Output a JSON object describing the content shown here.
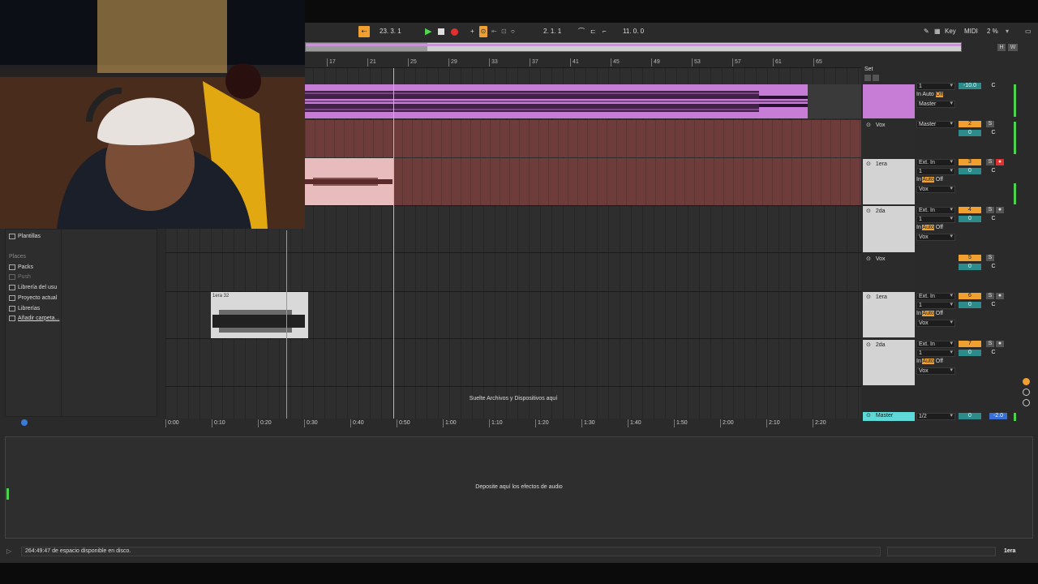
{
  "transport": {
    "position": "23.  3.  1",
    "loop_start": "2.  1.  1",
    "loop_length": "11.  0.  0",
    "key_label": "Key",
    "midi_label": "MIDI",
    "cpu": "2 %"
  },
  "overview": {
    "h_label": "H",
    "w_label": "W"
  },
  "ruler": [
    "17",
    "21",
    "25",
    "29",
    "33",
    "37",
    "41",
    "45",
    "49",
    "53",
    "57",
    "61",
    "65"
  ],
  "set_label": "Set",
  "browser": {
    "templates": "Plantillas",
    "places_header": "Places",
    "places": [
      "Packs",
      "Push",
      "Librería del usu",
      "Proyecto actual",
      "Librerías",
      "Añadir carpeta..."
    ]
  },
  "clip": {
    "name": "1era 32"
  },
  "drop_files": "Suelte Archivos y Dispositivos aquí",
  "drop_effects": "Deposite aquí los efectos de audio",
  "timeline": [
    "0:00",
    "0:10",
    "0:20",
    "0:30",
    "0:40",
    "0:50",
    "1:00",
    "1:10",
    "1:20",
    "1:30",
    "1:40",
    "1:50",
    "2:00",
    "2:10",
    "2:20"
  ],
  "tracks": [
    {
      "name": "",
      "input": "",
      "channel": "1",
      "in": "In",
      "auto": "Auto",
      "off": "Off",
      "output": "Master",
      "number": "",
      "vol": "-10.0",
      "pan": "C"
    },
    {
      "name": "Vox",
      "output": "Master",
      "number": "2",
      "solo": "S",
      "vol": "0",
      "pan": "C"
    },
    {
      "name": "1era",
      "input": "Ext. In",
      "channel": "1",
      "in": "In",
      "auto": "Auto",
      "off": "Off",
      "output": "Vox",
      "number": "3",
      "solo": "S",
      "vol": "0",
      "pan": "C"
    },
    {
      "name": "2da",
      "input": "Ext. In",
      "channel": "1",
      "in": "In",
      "auto": "Auto",
      "off": "Off",
      "output": "Vox",
      "number": "4",
      "solo": "S",
      "vol": "0",
      "pan": "C"
    },
    {
      "name": "Vox",
      "number": "5",
      "solo": "S",
      "vol": "0",
      "pan": "C"
    },
    {
      "name": "1era",
      "input": "Ext. In",
      "channel": "1",
      "in": "In",
      "auto": "Auto",
      "off": "Off",
      "output": "Vox",
      "number": "6",
      "solo": "S",
      "vol": "0",
      "pan": "C"
    },
    {
      "name": "2da",
      "input": "Ext. In",
      "channel": "1",
      "in": "In",
      "auto": "Auto",
      "off": "Off",
      "output": "Vox",
      "number": "7",
      "solo": "S",
      "vol": "0",
      "pan": "C"
    }
  ],
  "master": {
    "name": "Master",
    "channel": "1/2",
    "vol": "0",
    "vol2": "-2.0"
  },
  "status": {
    "disk": "264:49:47 de espacio disponible en disco.",
    "selected_track": "1era"
  },
  "colors": {
    "accent": "#f0a030",
    "clip_purple": "#c77dd6",
    "track_red": "#6e3d3b",
    "master": "#5fd8d8"
  }
}
